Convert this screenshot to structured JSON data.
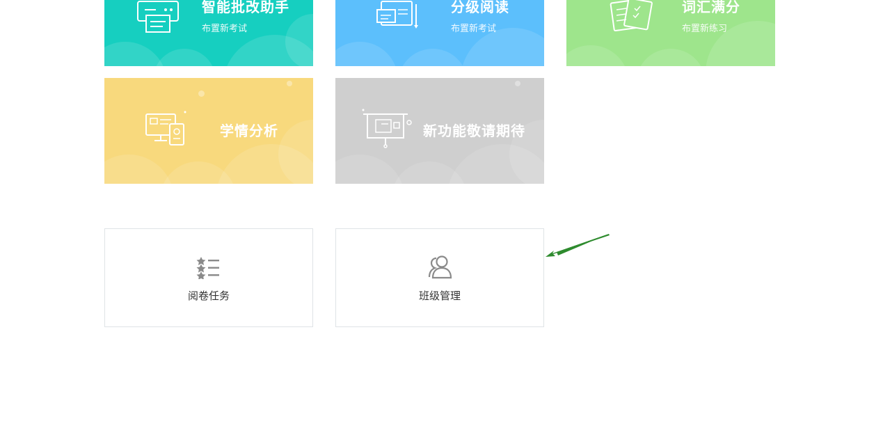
{
  "cards": [
    {
      "id": "smart-grading",
      "title": "智能批改助手",
      "subtitle": "布置新考试",
      "color": "#16cfc0"
    },
    {
      "id": "graded-reading",
      "title": "分级阅读",
      "subtitle": "布置新考试",
      "color": "#5cbffc"
    },
    {
      "id": "vocab-full",
      "title": "词汇满分",
      "subtitle": "布置新练习",
      "color": "#9ee58c"
    },
    {
      "id": "analytics",
      "title": "学情分析",
      "color": "#f8d97d"
    },
    {
      "id": "coming-soon",
      "title": "新功能敬请期待",
      "color": "#cfcfcf"
    }
  ],
  "tools": [
    {
      "id": "grading-tasks",
      "label": "阅卷任务",
      "icon": "star-list-icon"
    },
    {
      "id": "class-management",
      "label": "班级管理",
      "icon": "users-icon"
    }
  ],
  "annotation": {
    "arrow_color": "#2e8b2e"
  }
}
